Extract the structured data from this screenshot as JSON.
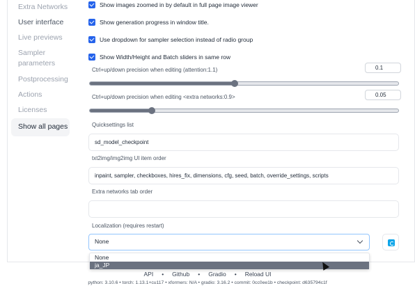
{
  "sidebar": {
    "items": [
      {
        "label": "Extra Networks"
      },
      {
        "label": "User interface"
      },
      {
        "label": "Live previews"
      },
      {
        "label": "Sampler parameters"
      },
      {
        "label": "Postprocessing"
      },
      {
        "label": "Actions"
      },
      {
        "label": "Licenses"
      }
    ],
    "show_all": "Show all pages"
  },
  "checkboxes": [
    {
      "label": "Show images zoomed in by default in full page image viewer",
      "checked": true
    },
    {
      "label": "Show generation progress in window title.",
      "checked": true
    },
    {
      "label": "Use dropdown for sampler selection instead of radio group",
      "checked": true
    },
    {
      "label": "Show Width/Height and Batch sliders in same row",
      "checked": true
    }
  ],
  "attention": {
    "label": "Ctrl+up/down precision when editing (attention:1.1)",
    "value": "0.1",
    "fraction": 0.47
  },
  "extra_networks": {
    "label": "Ctrl+up/down precision when editing <extra networks:0.9>",
    "value": "0.05",
    "fraction": 0.2
  },
  "quicksettings": {
    "label": "Quicksettings list",
    "value": "sd_model_checkpoint"
  },
  "ui_order": {
    "label": "txt2img/img2img UI item order",
    "value": "inpaint, sampler, checkboxes, hires_fix, dimensions, cfg, seed, batch, override_settings, scripts"
  },
  "tab_order": {
    "label": "Extra networks tab order",
    "value": ""
  },
  "localization": {
    "label": "Localization (requires restart)",
    "value": "None",
    "options": [
      "None",
      "ja_JP"
    ]
  },
  "footer": {
    "links": [
      "API",
      "Github",
      "Gradio",
      "Reload UI"
    ],
    "separator": "•",
    "versions": "python: 3.10.6  •  torch: 1.13.1+cu117  •  xformers: N/A  •  gradio: 3.16.2  •  commit: 0cc0ee1b  •  checkpoint: d635794c1f"
  }
}
